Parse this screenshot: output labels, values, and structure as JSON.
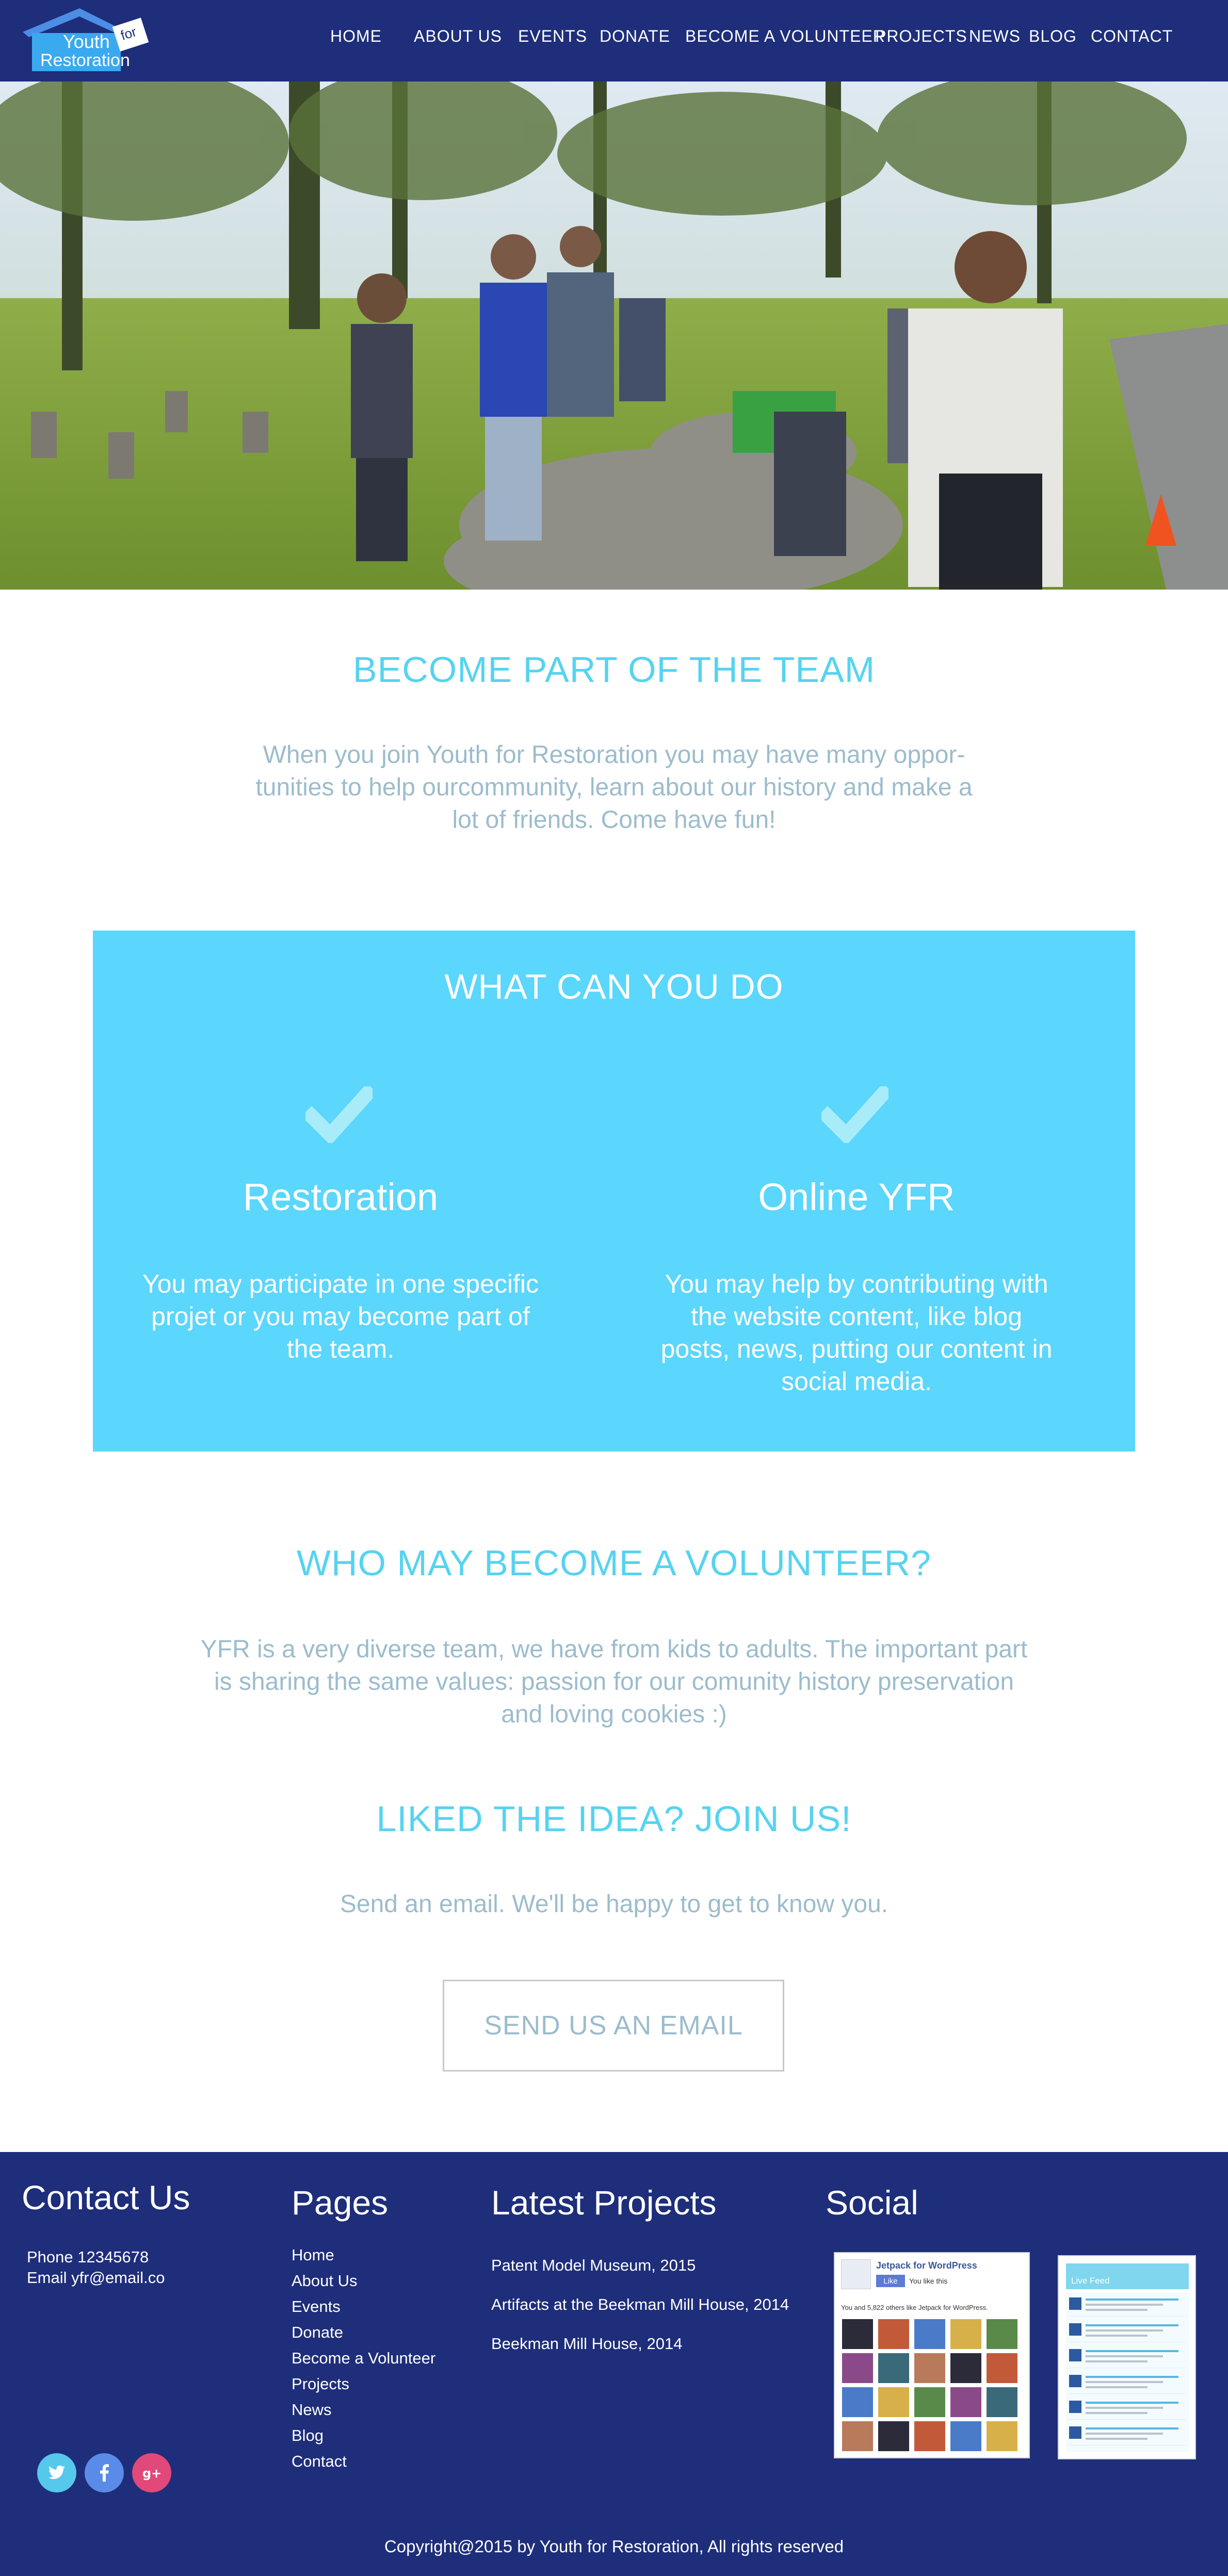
{
  "header": {
    "logo_line1": "Youth",
    "logo_for": "for",
    "logo_line2": "Restoration",
    "nav": [
      "HOME",
      "ABOUT US",
      "EVENTS",
      "DONATE",
      "BECOME A VOLUNTEER",
      "PROJECTS",
      "NEWS",
      "BLOG",
      "CONTACT"
    ]
  },
  "intro": {
    "title": "BECOME PART OF THE TEAM",
    "lines": [
      "When you join Youth for Restoration you may have many oppor-",
      "tunities to help ourcommunity, learn about our history and make a",
      "lot of friends. Come have fun!"
    ]
  },
  "what_box": {
    "title": "WHAT CAN YOU DO",
    "columns": [
      {
        "title": "Restoration",
        "lines": [
          "You may participate in one specific",
          "projet or you may become part of",
          "the team."
        ]
      },
      {
        "title": "Online YFR",
        "lines": [
          "You may help by contributing with",
          "the website content, like blog",
          "posts, news, putting our content in",
          "social media."
        ]
      }
    ]
  },
  "who": {
    "title": "WHO MAY BECOME A VOLUNTEER?",
    "lines": [
      "YFR is a very diverse team, we have from kids to adults. The important part",
      "is sharing the same values: passion for our comunity history preservation",
      "and loving cookies :)"
    ]
  },
  "join": {
    "title": "LIKED THE IDEA? JOIN US!",
    "text": "Send an email. We'll be happy to get to know you.",
    "button": "SEND US AN EMAIL"
  },
  "footer": {
    "contact_title": "Contact Us",
    "phone": "Phone 12345678",
    "email": "Email yfr@email.co",
    "pages_title": "Pages",
    "pages": [
      "Home",
      "About Us",
      "Events",
      "Donate",
      "Become a Volunteer",
      "Projects",
      "News",
      "Blog",
      "Contact"
    ],
    "projects_title": "Latest Projects",
    "projects": [
      "Patent Model Museum, 2015",
      "Artifacts at the Beekman Mill House, 2014",
      "Beekman Mill House, 2014"
    ],
    "social_title": "Social",
    "fb_widget": {
      "page_name": "Jetpack for WordPress",
      "like_label": "Like",
      "like_text": "You like this",
      "friends_text": "You and 5,822 others like Jetpack for WordPress."
    },
    "tw_widget": {
      "header": "Live Feed"
    },
    "copyright": "Copyright@2015 by Youth for Restoration, All rights reserved"
  },
  "colors": {
    "navy": "#1e2e7a",
    "cyan": "#56d3f0",
    "box": "#5bd6fc",
    "twitter": "#55c8ec",
    "facebook": "#5b8be8",
    "google": "#e0497a"
  },
  "icons": [
    "check-icon",
    "twitter-icon",
    "facebook-icon",
    "google-plus-icon"
  ]
}
